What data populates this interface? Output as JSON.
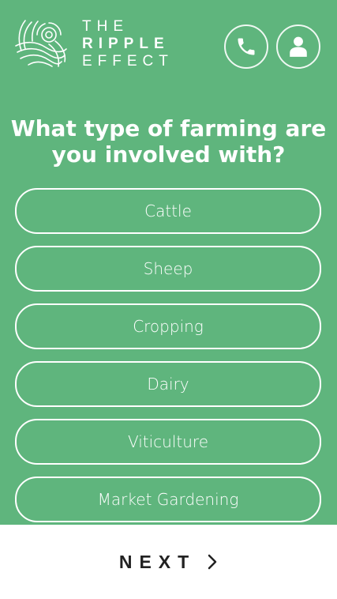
{
  "header": {
    "logo": {
      "line1": "THE",
      "line2": "RIPPLE",
      "line3": "EFFECT"
    },
    "phone_icon": "phone-icon",
    "user_icon": "user-icon"
  },
  "question": {
    "text": "What type of farming are you involved with?"
  },
  "options": [
    {
      "label": "Cattle"
    },
    {
      "label": "Sheep"
    },
    {
      "label": "Cropping"
    },
    {
      "label": "Dairy"
    },
    {
      "label": "Viticulture"
    },
    {
      "label": "Market Gardening"
    },
    {
      "label": ""
    }
  ],
  "footer": {
    "next_label": "NEXT",
    "next_icon": "chevron-right-icon"
  },
  "colors": {
    "background": "#5fb57d",
    "text": "#ffffff",
    "footer_background": "#ffffff",
    "footer_text": "#222222"
  }
}
